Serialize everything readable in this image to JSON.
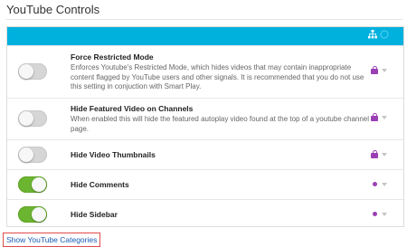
{
  "section": {
    "title": "YouTube Controls"
  },
  "header_icons": {
    "network": "sitemap-icon",
    "toggle": "circle-icon"
  },
  "colors": {
    "header": "#00b1de",
    "toggle_on": "#6cb531",
    "toggle_off": "#d6d6d6",
    "lock": "#9b3fb5",
    "link": "#1a5bb5",
    "link_border": "#e14b4b"
  },
  "settings": [
    {
      "title": "Force Restricted Mode",
      "description": "Enforces Youtube's Restricted Mode, which hides videos that may contain inappropriate content flagged by YouTube users and other signals. It is recommended that you do not use this setting in conjuction with Smart Play.",
      "enabled": false,
      "status_icon": "lock-icon"
    },
    {
      "title": "Hide Featured Video on Channels",
      "description": "When enabled this will hide the featured autoplay video found at the top of a youtube channel page.",
      "enabled": false,
      "status_icon": "lock-icon"
    },
    {
      "title": "Hide Video Thumbnails",
      "description": "",
      "enabled": false,
      "status_icon": "lock-icon"
    },
    {
      "title": "Hide Comments",
      "description": "",
      "enabled": true,
      "status_icon": "dot-icon"
    },
    {
      "title": "Hide Sidebar",
      "description": "",
      "enabled": true,
      "status_icon": "dot-icon"
    }
  ],
  "footer": {
    "link_label": "Show YouTube Categories"
  }
}
